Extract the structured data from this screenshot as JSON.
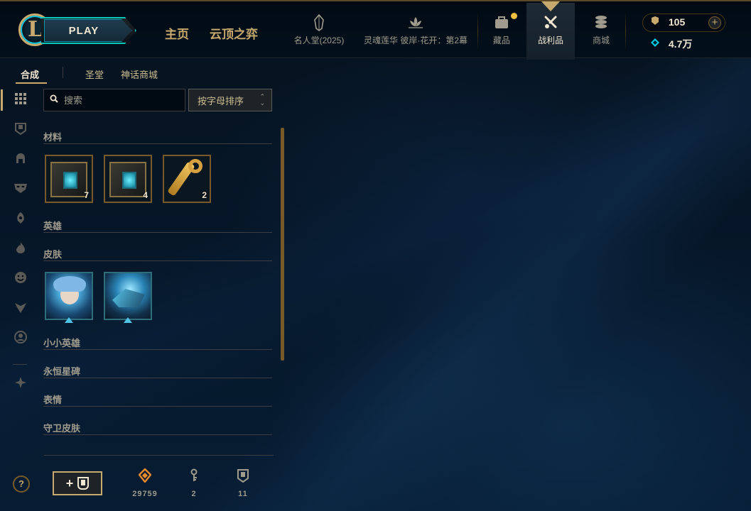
{
  "header": {
    "play_label": "PLAY",
    "nav_main": [
      {
        "label": "主页"
      },
      {
        "label": "云顶之弈"
      }
    ],
    "nav_icons": [
      {
        "label": "名人堂(2025)",
        "icon": "crystal-icon"
      },
      {
        "label": "灵魂莲华 彼岸·花开：第2幕",
        "icon": "lotus-icon"
      },
      {
        "label": "藏品",
        "icon": "collection-bag-icon"
      },
      {
        "label": "战利品",
        "icon": "loot-icon"
      },
      {
        "label": "商城",
        "icon": "store-coins-icon"
      }
    ],
    "currency": {
      "rp": "105",
      "be": "4.7万"
    }
  },
  "subnav": {
    "tabs": [
      {
        "label": "合成"
      },
      {
        "label": "圣堂"
      },
      {
        "label": "神话商城"
      }
    ]
  },
  "rail": {
    "icons": [
      "grid-icon",
      "chest-filter-icon",
      "helmet-icon",
      "mask-icon",
      "ward-icon",
      "flame-icon",
      "emote-icon",
      "tft-icon",
      "profile-icon",
      "misc-icon"
    ]
  },
  "toolbar": {
    "search_placeholder": "搜索",
    "sort_label": "按字母排序"
  },
  "categories": {
    "materials": "材料",
    "champions": "英雄",
    "skins": "皮肤",
    "little_legends": "小小英雄",
    "eternals": "永恒星碑",
    "emotes": "表情",
    "ward_skins": "守卫皮肤"
  },
  "materials": [
    {
      "name": "hextech-chest",
      "count": "7"
    },
    {
      "name": "masterwork-chest",
      "count": "4"
    },
    {
      "name": "hextech-key",
      "count": "2"
    }
  ],
  "skins": [
    {
      "name": "skin-shard-1"
    },
    {
      "name": "skin-shard-2"
    }
  ],
  "footer": {
    "help_label": "?",
    "craft_label": "+",
    "stats": [
      {
        "icon": "orange-essence-icon",
        "value": "29759",
        "color": "#e8892c"
      },
      {
        "icon": "key-fragment-icon",
        "value": "2",
        "color": "#a09b8c"
      },
      {
        "icon": "chest-count-icon",
        "value": "11",
        "color": "#a09b8c"
      }
    ]
  }
}
